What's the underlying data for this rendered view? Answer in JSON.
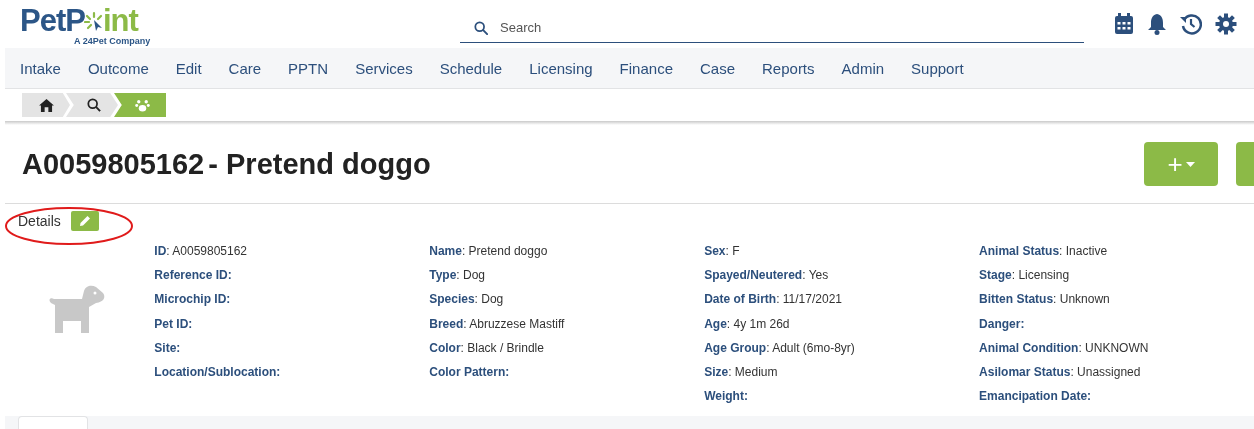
{
  "logo": {
    "parts": [
      "PetP",
      "int"
    ],
    "tagline": "A 24Pet Company"
  },
  "search": {
    "placeholder": "Search"
  },
  "nav": [
    "Intake",
    "Outcome",
    "Edit",
    "Care",
    "PPTN",
    "Services",
    "Schedule",
    "Licensing",
    "Finance",
    "Case",
    "Reports",
    "Admin",
    "Support"
  ],
  "breadcrumb": [
    {
      "kind": "home",
      "selected": false
    },
    {
      "kind": "search",
      "selected": false
    },
    {
      "kind": "paw",
      "selected": true
    }
  ],
  "title": {
    "id": "A0059805162",
    "separator": "-",
    "name": "Pretend doggo"
  },
  "add_button": {
    "label": "+"
  },
  "details": {
    "title": "Details",
    "circled": true
  },
  "columns": [
    [
      "**ID**: A0059805162",
      "**Reference ID:**",
      "**Microchip ID:**",
      "**Pet ID:**",
      "**Site:**",
      "**Location/Sublocation:**"
    ],
    [
      "**Name**: Pretend doggo",
      "**Type**: Dog",
      "**Species**: Dog",
      "**Breed**: Abruzzese Mastiff",
      "**Color**: Black / Brindle",
      "**Color Pattern:**"
    ],
    [
      "**Sex**: F",
      "**Spayed/Neutered**: Yes",
      "**Date of Birth**: 11/17/2021",
      "**Age**: 4y 1m 26d",
      "**Age Group**: Adult (6mo-8yr)",
      "**Size**: Medium",
      "**Weight:**"
    ],
    [
      "**Animal Status**: Inactive",
      "**Stage**: Licensing",
      "**Bitten Status**: Unknown",
      "**Danger:**",
      "**Animal Condition**: UNKNOWN",
      "**Asilomar Status**: Unassigned",
      "**Emancipation Date:**"
    ]
  ]
}
